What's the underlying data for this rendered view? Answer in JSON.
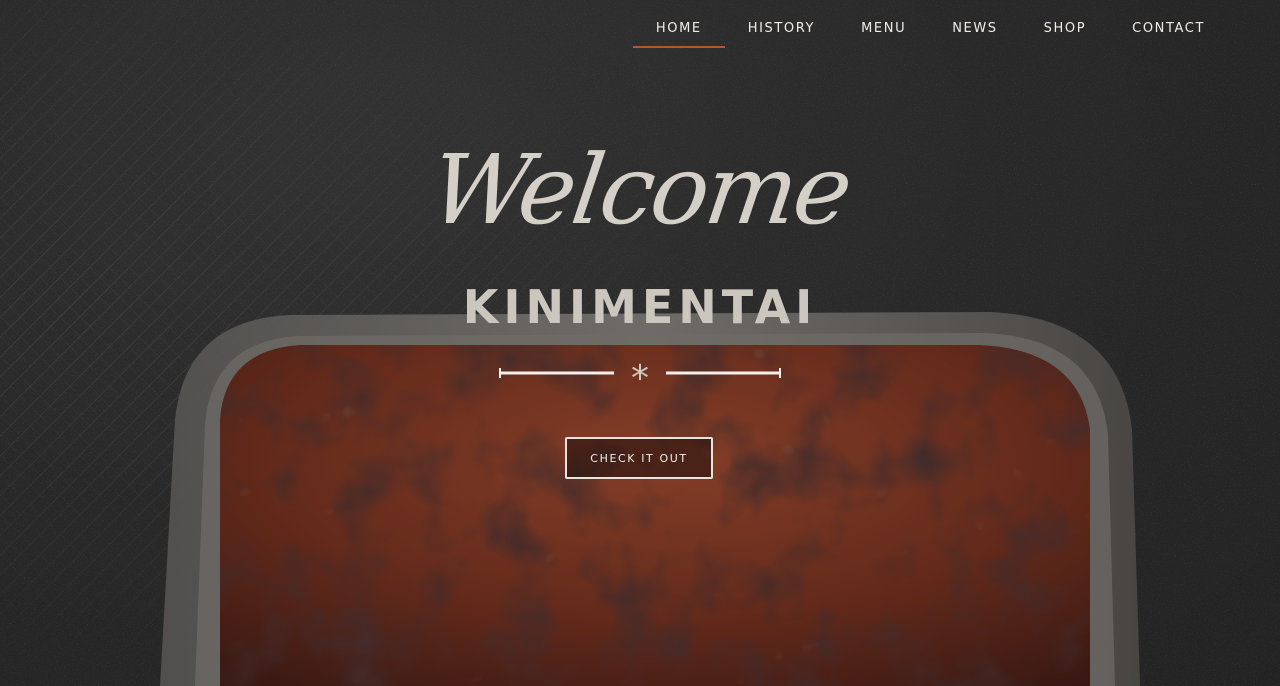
{
  "nav": {
    "items": [
      {
        "label": "HOME",
        "active": true
      },
      {
        "label": "HISTORY",
        "active": false
      },
      {
        "label": "MENU",
        "active": false
      },
      {
        "label": "NEWS",
        "active": false
      },
      {
        "label": "SHOP",
        "active": false
      },
      {
        "label": "CONTACT",
        "active": false
      }
    ]
  },
  "hero": {
    "welcome": "Welcome",
    "brand": "KINIMENTAI",
    "divider_glyph": "*",
    "cta_label": "CHECK IT OUT"
  },
  "colors": {
    "accent": "#b5562f",
    "background": "#2b2b2b",
    "text": "#f1ece6"
  }
}
